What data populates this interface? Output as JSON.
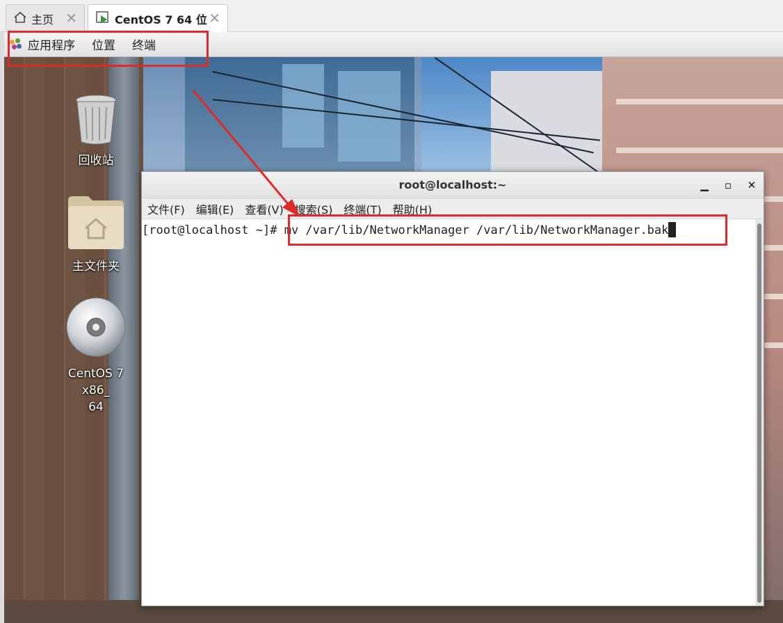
{
  "tabs": [
    {
      "label": "主页",
      "icon": "home-icon"
    },
    {
      "label": "CentOS 7 64 位",
      "icon": "vm-play-icon"
    }
  ],
  "gnome_panel": {
    "items": [
      "应用程序",
      "位置",
      "终端"
    ]
  },
  "desktop_icons": [
    {
      "label": "回收站",
      "icon": "trash-icon"
    },
    {
      "label": "主文件夹",
      "icon": "home-folder-icon"
    },
    {
      "label": "CentOS 7 x86_\n64",
      "icon": "cdrom-icon"
    }
  ],
  "terminal": {
    "title": "root@localhost:~",
    "menu": [
      "文件(F)",
      "编辑(E)",
      "查看(V)",
      "搜索(S)",
      "终端(T)",
      "帮助(H)"
    ],
    "prompt": "[root@localhost ~]# ",
    "command": "mv /var/lib/NetworkManager /var/lib/NetworkManager.bak"
  },
  "annotation_color": "#e02a2a"
}
